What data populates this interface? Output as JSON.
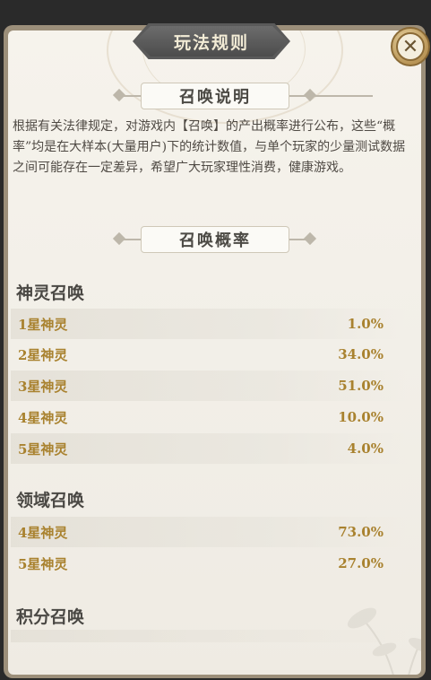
{
  "dialog": {
    "title": "玩法规则",
    "close_label": "✕"
  },
  "summon_info": {
    "heading": "召唤说明",
    "description": "根据有关法律规定，对游戏内【召唤】的产出概率进行公布，这些“概率”均是在大样本(大量用户)下的统计数值，与单个玩家的少量测试数据之间可能存在一定差异，希望广大玩家理性消费，健康游戏。"
  },
  "summon_rates": {
    "heading": "召唤概率",
    "groups": [
      {
        "title": "神灵召唤",
        "rows": [
          {
            "label": "1星神灵",
            "value": "1.0%"
          },
          {
            "label": "2星神灵",
            "value": "34.0%"
          },
          {
            "label": "3星神灵",
            "value": "51.0%"
          },
          {
            "label": "4星神灵",
            "value": "10.0%"
          },
          {
            "label": "5星神灵",
            "value": "4.0%"
          }
        ]
      },
      {
        "title": "领域召唤",
        "rows": [
          {
            "label": "4星神灵",
            "value": "73.0%"
          },
          {
            "label": "5星神灵",
            "value": "27.0%"
          }
        ]
      },
      {
        "title": "积分召唤",
        "rows": []
      }
    ]
  },
  "colors": {
    "accent_gold": "#a9822f",
    "panel_bg": "#f4f1ea",
    "title_plate": "#5a5a5a"
  }
}
